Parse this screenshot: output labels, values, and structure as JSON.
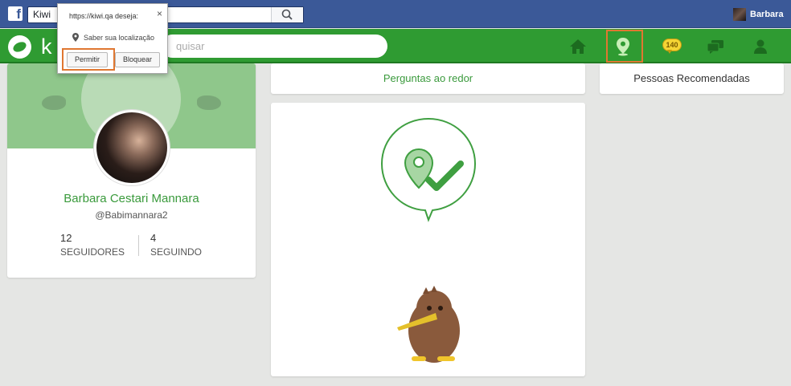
{
  "facebook": {
    "logo_letter": "f",
    "search_value": "Kiwi",
    "user_name": "Barbara"
  },
  "kiwi": {
    "logo_text": "k",
    "search_placeholder": "quisar",
    "nav": {
      "notifications_count": "140"
    }
  },
  "permission_popup": {
    "title": "https://kiwi.qa deseja:",
    "close_label": "×",
    "request_label": "Saber sua localização",
    "allow_label": "Permitir",
    "block_label": "Bloquear"
  },
  "profile": {
    "name": "Barbara Cestari Mannara",
    "handle": "@Babimannara2",
    "followers_count": "12",
    "followers_label": "SEGUIDORES",
    "following_count": "4",
    "following_label": "SEGUINDO"
  },
  "center": {
    "tab_label": "Perguntas ao redor"
  },
  "right": {
    "recommended_label": "Pessoas Recomendadas"
  },
  "colors": {
    "kiwi_green": "#2f9b32",
    "facebook_blue": "#3b5998",
    "highlight_orange": "#e07731",
    "badge_yellow": "#f5d434"
  }
}
